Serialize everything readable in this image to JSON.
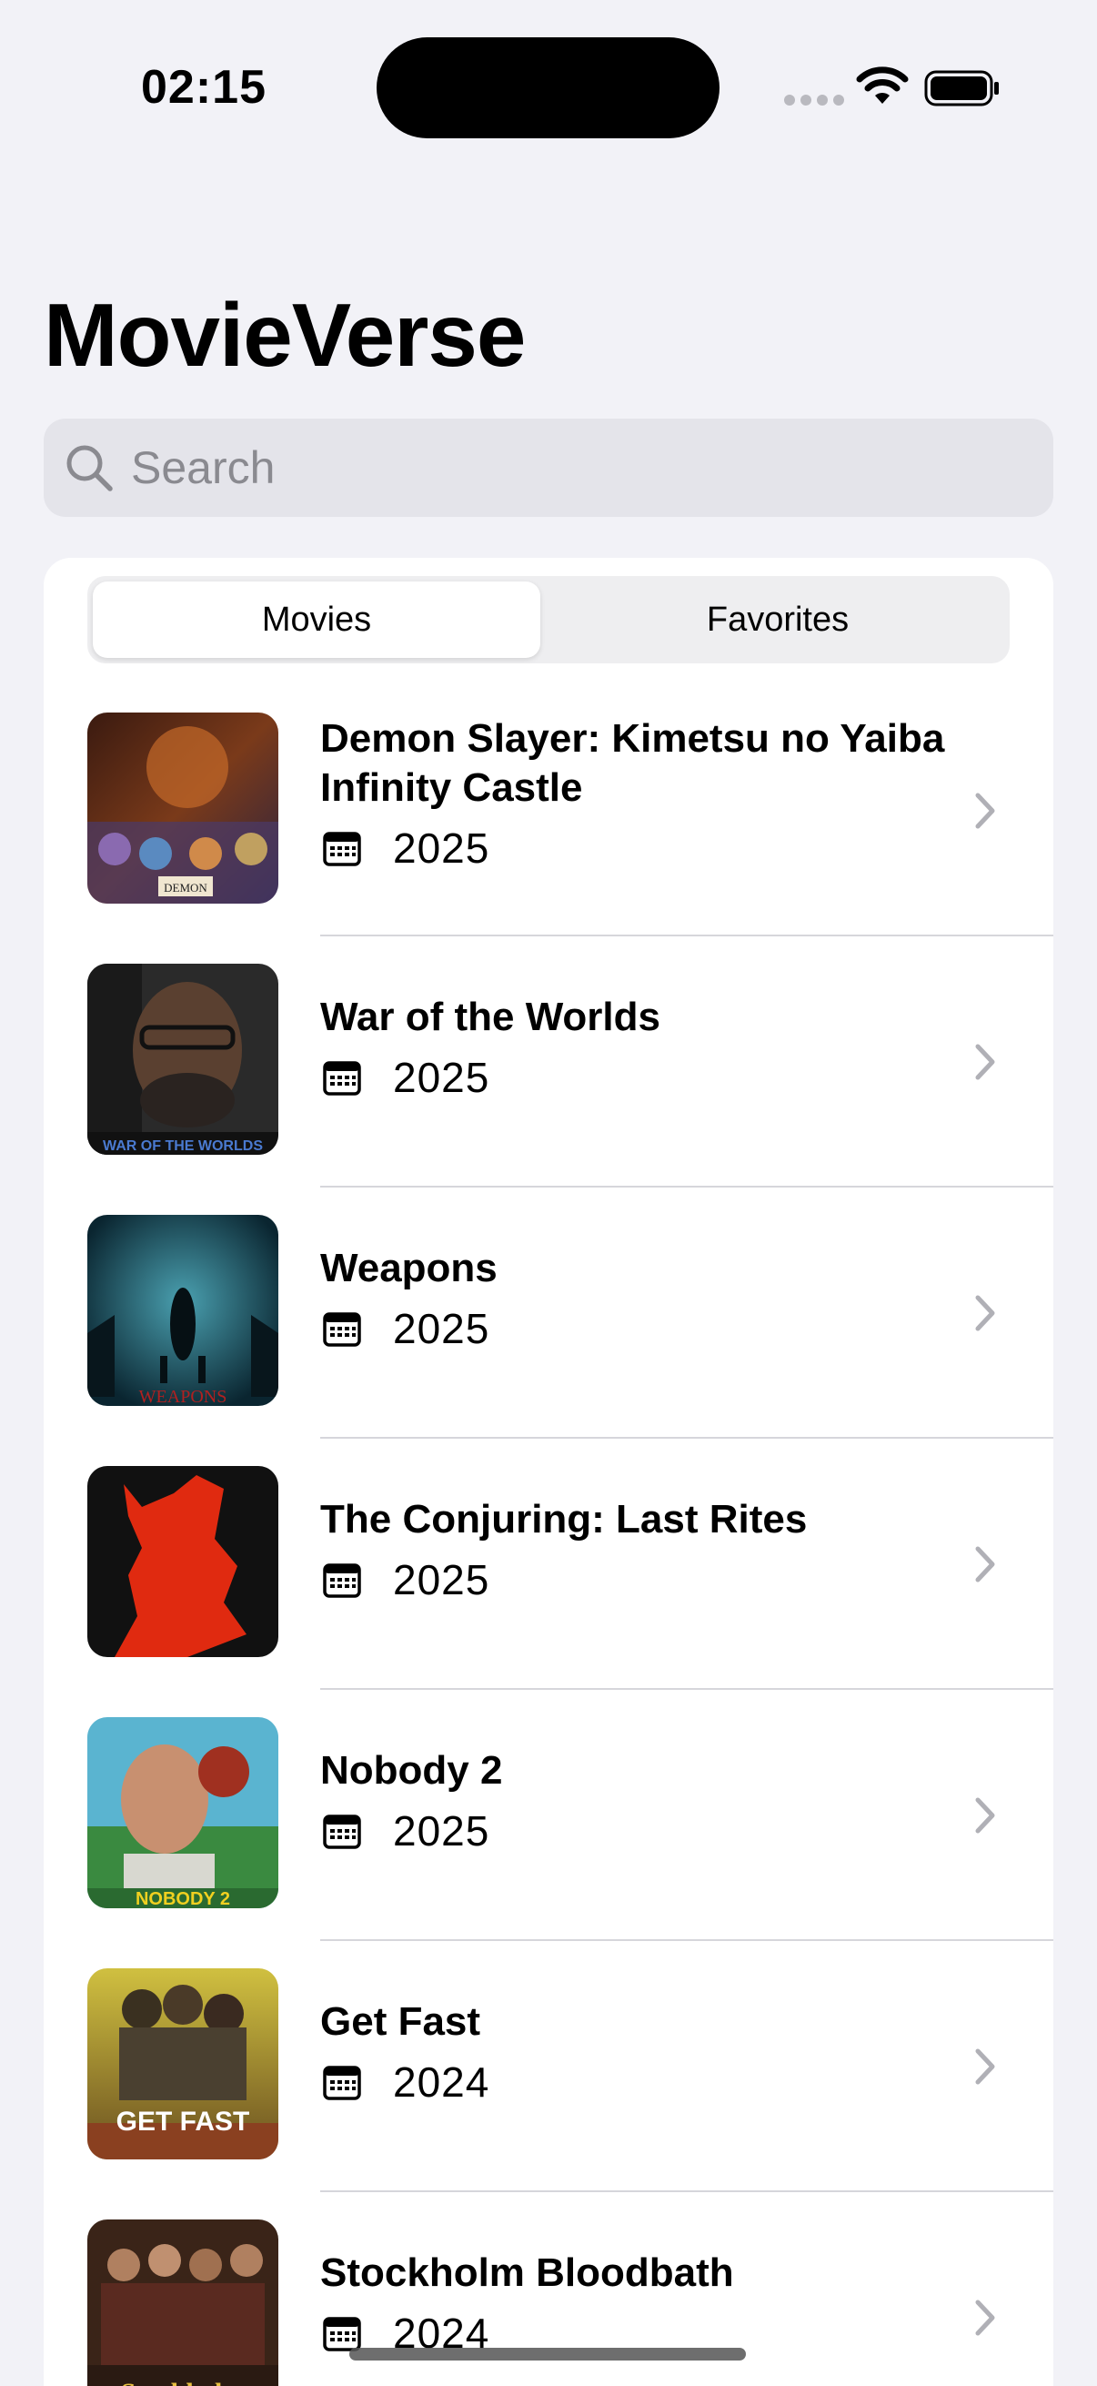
{
  "status_bar": {
    "time": "02:15"
  },
  "header": {
    "title": "MovieVerse"
  },
  "search": {
    "placeholder": "Search"
  },
  "segments": {
    "movies": "Movies",
    "favorites": "Favorites",
    "selected": "Movies"
  },
  "movies": [
    {
      "title": "Demon Slayer: Kimetsu no Yaiba Infinity Castle",
      "year": "2025",
      "poster_text": "DEMON"
    },
    {
      "title": "War of the Worlds",
      "year": "2025",
      "poster_text": "WAR OF THE WORLDS"
    },
    {
      "title": "Weapons",
      "year": "2025",
      "poster_text": "WEAPONS"
    },
    {
      "title": "The Conjuring: Last Rites",
      "year": "2025",
      "poster_text": ""
    },
    {
      "title": "Nobody 2",
      "year": "2025",
      "poster_text": "NOBODY 2"
    },
    {
      "title": "Get Fast",
      "year": "2024",
      "poster_text": "GET FAST"
    },
    {
      "title": "Stockholm Bloodbath",
      "year": "2024",
      "poster_text": "Stockholm"
    }
  ],
  "icons": {
    "search": "magnifying-glass-icon",
    "calendar": "calendar-icon",
    "chevron": "chevron-right-icon"
  }
}
